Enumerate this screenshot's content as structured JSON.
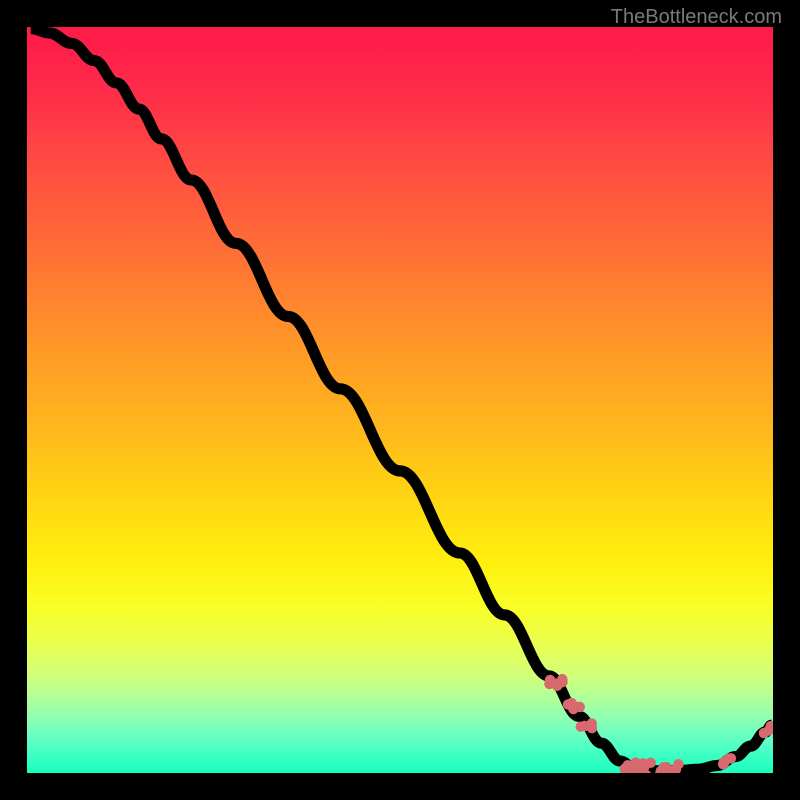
{
  "attribution": "TheBottleneck.com",
  "chart_data": {
    "type": "line",
    "title": "",
    "xlabel": "",
    "ylabel": "",
    "xlim": [
      0,
      100
    ],
    "ylim": [
      0,
      100
    ],
    "curve": [
      {
        "x": 0.5,
        "y": 99.8
      },
      {
        "x": 3.0,
        "y": 99.2
      },
      {
        "x": 6.0,
        "y": 97.8
      },
      {
        "x": 9.0,
        "y": 95.5
      },
      {
        "x": 12.0,
        "y": 92.5
      },
      {
        "x": 15.0,
        "y": 89.0
      },
      {
        "x": 18.0,
        "y": 85.0
      },
      {
        "x": 22.0,
        "y": 79.5
      },
      {
        "x": 28.0,
        "y": 71.0
      },
      {
        "x": 35.0,
        "y": 61.2
      },
      {
        "x": 42.0,
        "y": 51.5
      },
      {
        "x": 50.0,
        "y": 40.5
      },
      {
        "x": 58.0,
        "y": 29.5
      },
      {
        "x": 64.0,
        "y": 21.2
      },
      {
        "x": 70.0,
        "y": 13.0
      },
      {
        "x": 74.0,
        "y": 7.6
      },
      {
        "x": 77.0,
        "y": 4.0
      },
      {
        "x": 79.5,
        "y": 1.6
      },
      {
        "x": 81.5,
        "y": 0.6
      },
      {
        "x": 84.0,
        "y": 0.3
      },
      {
        "x": 87.0,
        "y": 0.3
      },
      {
        "x": 90.0,
        "y": 0.5
      },
      {
        "x": 92.5,
        "y": 1.0
      },
      {
        "x": 95.0,
        "y": 2.2
      },
      {
        "x": 97.0,
        "y": 3.6
      },
      {
        "x": 99.0,
        "y": 5.5
      },
      {
        "x": 99.8,
        "y": 6.4
      }
    ],
    "dot_clusters": [
      {
        "cx": 70.5,
        "cy": 12.3,
        "count": 8,
        "spread": 1.4
      },
      {
        "cx": 73.0,
        "cy": 9.0,
        "count": 5,
        "spread": 1.1
      },
      {
        "cx": 75.0,
        "cy": 6.3,
        "count": 4,
        "spread": 0.9
      },
      {
        "cx": 82.0,
        "cy": 0.5,
        "count": 14,
        "spread": 2.2
      },
      {
        "cx": 86.0,
        "cy": 0.4,
        "count": 10,
        "spread": 1.8
      },
      {
        "cx": 93.0,
        "cy": 1.2,
        "count": 3,
        "spread": 0.7
      },
      {
        "cx": 94.5,
        "cy": 2.0,
        "count": 2,
        "spread": 0.5
      },
      {
        "cx": 99.0,
        "cy": 5.5,
        "count": 2,
        "spread": 0.5
      },
      {
        "cx": 99.7,
        "cy": 6.3,
        "count": 2,
        "spread": 0.4
      }
    ],
    "colors": {
      "top": "#ff1a4a",
      "mid": "#ffd812",
      "bottom": "#18ffc0",
      "curve": "#000000",
      "dots": "#d86a6f",
      "frame": "#000000"
    }
  }
}
